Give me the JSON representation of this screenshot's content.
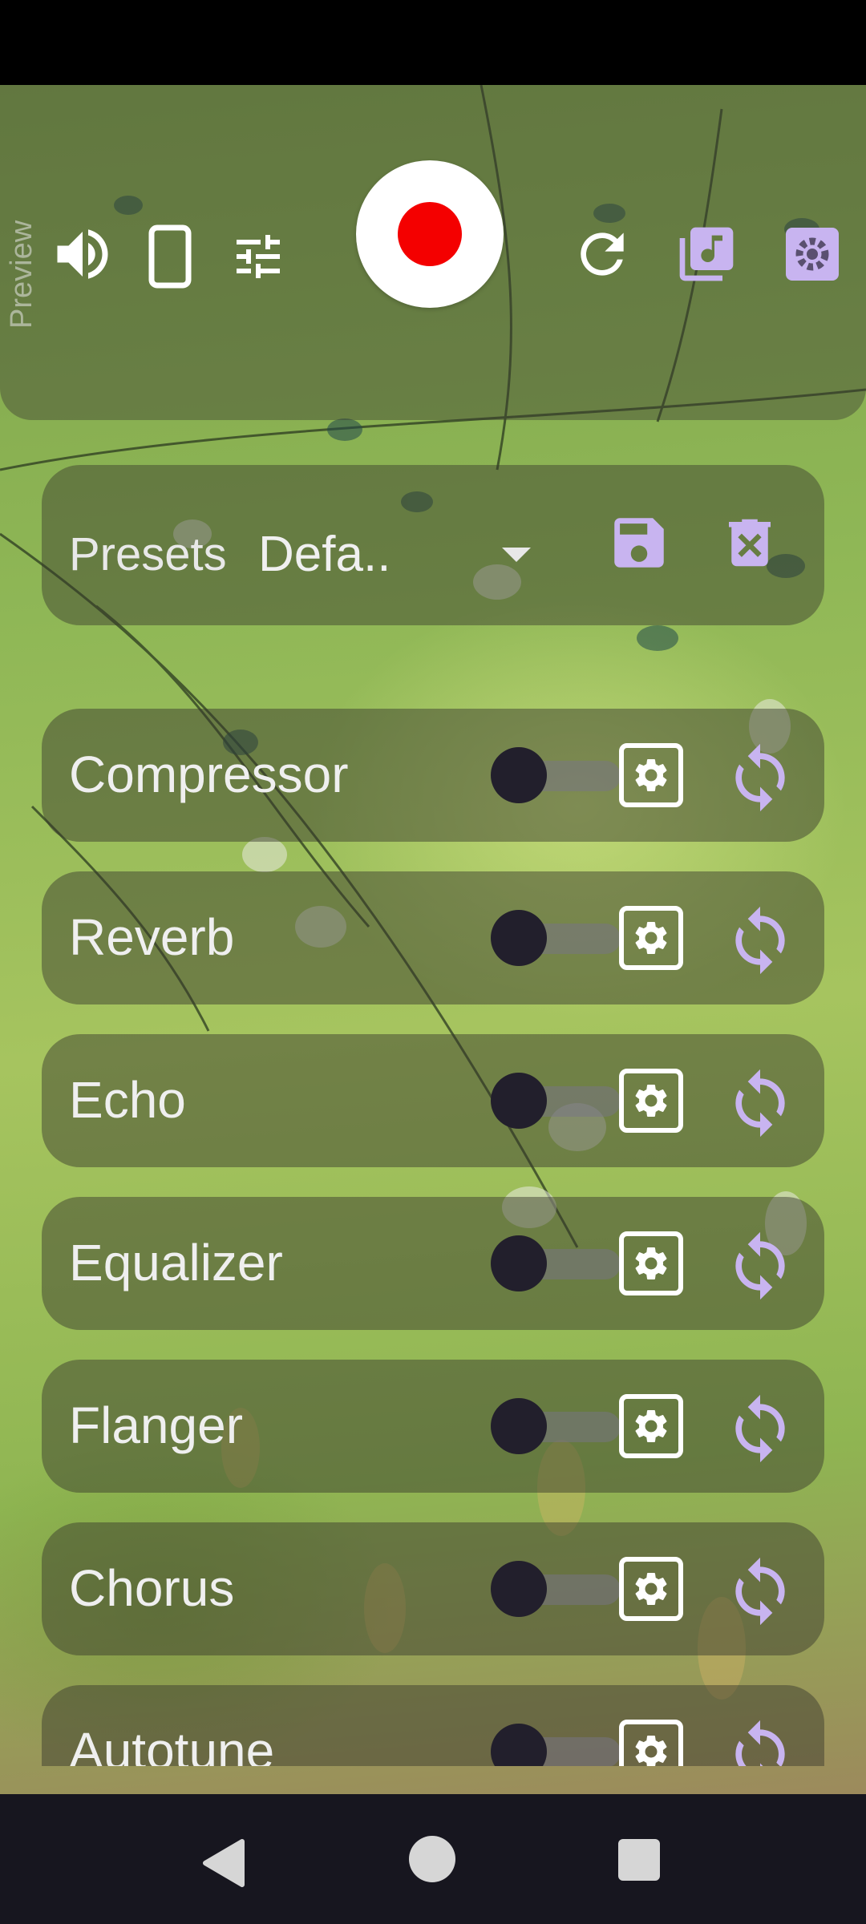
{
  "top_bar": {
    "preview_label": "Preview",
    "icons": [
      "volume-icon",
      "phone-icon",
      "equalizer-sliders-icon",
      "record-icon",
      "refresh-icon",
      "music-library-icon",
      "settings-icon"
    ]
  },
  "presets": {
    "label": "Presets",
    "selected": "Defa.."
  },
  "effects": [
    {
      "name": "Compressor",
      "enabled": false
    },
    {
      "name": "Reverb",
      "enabled": false
    },
    {
      "name": "Echo",
      "enabled": false
    },
    {
      "name": "Equalizer",
      "enabled": false
    },
    {
      "name": "Flanger",
      "enabled": false
    },
    {
      "name": "Chorus",
      "enabled": false
    },
    {
      "name": "Autotune",
      "enabled": false
    }
  ],
  "colors": {
    "accent": "#c8b4f0",
    "record": "#f40000",
    "navbar": "#17161f"
  }
}
